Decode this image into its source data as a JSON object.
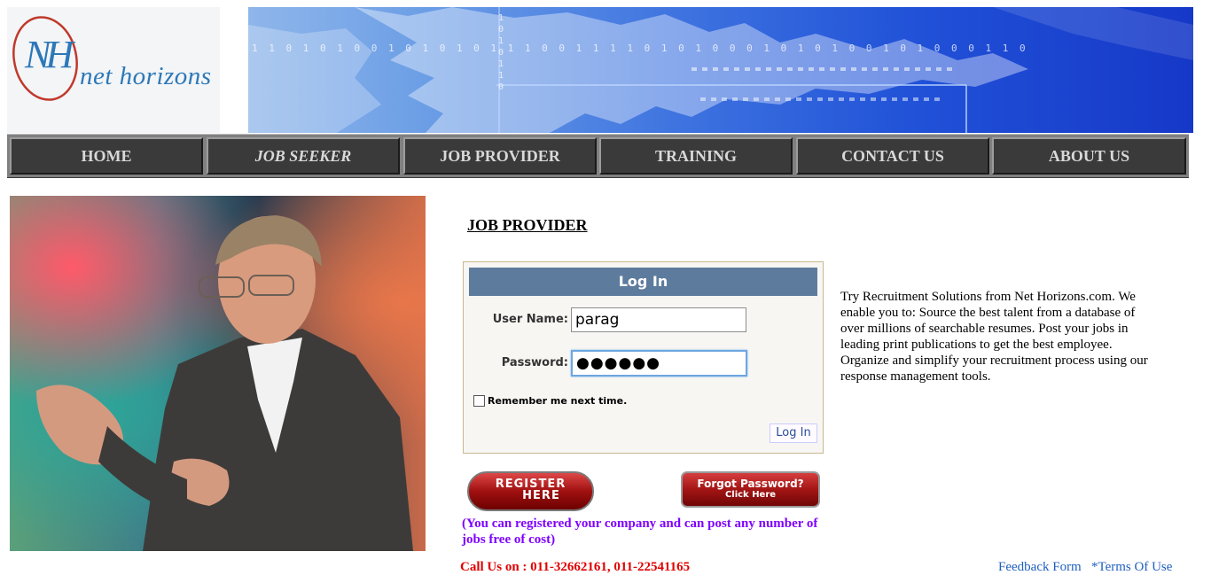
{
  "header": {
    "logo_initials": "NH",
    "logo_text": "net horizons",
    "banner_binary_top": "1 1 0 1 0 1 0 0 1 0 1 0 1 0 1 1 1 0 0 1 1 1 1 0 1 0 1 0 0 0 1 0 1 0 1 0 0 1 0 1 0 0 0 1 1 0",
    "banner_binary_side": "1 0 1 0 1 1 0"
  },
  "nav": {
    "items": [
      {
        "label": "HOME",
        "active": false
      },
      {
        "label": "JOB SEEKER",
        "active": true
      },
      {
        "label": "JOB PROVIDER",
        "active": false
      },
      {
        "label": "TRAINING",
        "active": false
      },
      {
        "label": "CONTACT US",
        "active": false
      },
      {
        "label": "ABOUT US",
        "active": false
      }
    ]
  },
  "page": {
    "heading": "JOB PROVIDER"
  },
  "login": {
    "title": "Log In",
    "username_label": "User Name:",
    "username_value": "parag",
    "password_label": "Password:",
    "password_value": "●●●●●●",
    "remember_label": "Remember me next time.",
    "remember_checked": false,
    "button_label": "Log In"
  },
  "buttons": {
    "register_line1": "REGISTER",
    "register_line2": "HERE",
    "forgot_line1": "Forgot Password?",
    "forgot_line2": "Click Here"
  },
  "register_note": "(You can registered your company and can post any number of jobs free of cost)",
  "description": "Try Recruitment Solutions from Net Horizons.com. We enable you to: Source the best talent from a database of over millions of searchable resumes. Post your jobs in leading print publications to get the best employee. Organize and simplify your recruitment process using our response management tools.",
  "footer": {
    "call_us": "Call Us on :    011-32662161, 011-22541165",
    "feedback_link": "Feedback Form",
    "terms_link": "*Terms Of Use"
  },
  "colors": {
    "nav_background": "#3a3a3a",
    "login_title_bar": "#5d7b9d",
    "register_note": "#7f00ff",
    "call_us": "#e00000",
    "links": "#1f5fbf"
  }
}
